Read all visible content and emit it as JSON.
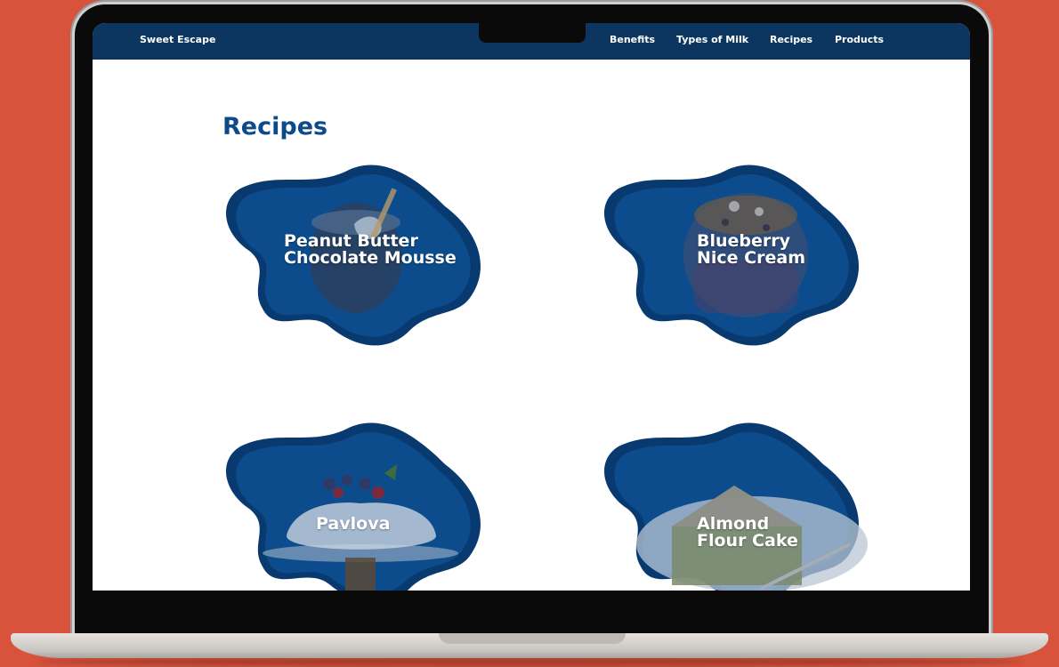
{
  "site": {
    "brand": "Sweet Escape"
  },
  "nav": {
    "links": [
      "Benefits",
      "Types of Milk",
      "Recipes",
      "Products"
    ]
  },
  "page": {
    "title": "Recipes"
  },
  "recipes": [
    {
      "line1": "Peanut Butter",
      "line2": "Chocolate Mousse"
    },
    {
      "line1": "Blueberry",
      "line2": "Nice Cream"
    },
    {
      "line1": "Pavlova",
      "line2": ""
    },
    {
      "line1": "Almond",
      "line2": "Flour Cake"
    }
  ],
  "colors": {
    "background": "#d9523b",
    "nav": "#0c3660",
    "title": "#0c4a8a",
    "blob": "#0d4c8c",
    "blob_edge": "#083a70"
  }
}
